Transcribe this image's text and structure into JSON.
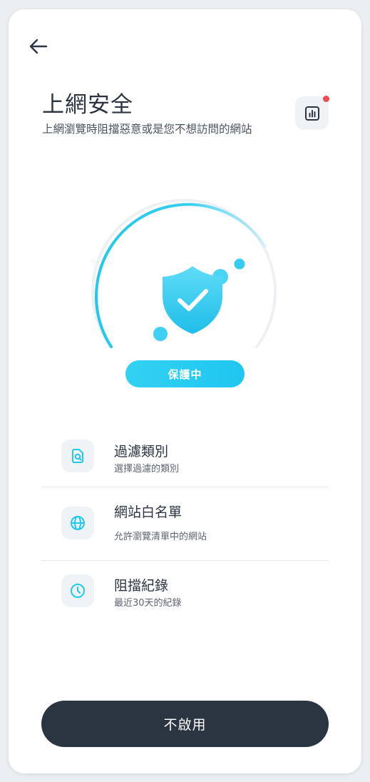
{
  "header": {
    "back_icon": "arrow-left-icon",
    "title": "上網安全",
    "subtitle": "上網瀏覽時阻擋惡意或是您不想訪問的網站",
    "report_icon": "bar-chart-icon",
    "notification_color": "#ee4b4b"
  },
  "status": {
    "label": "保護中",
    "shield_icon": "shield-check-icon",
    "accent": "#22c8f0"
  },
  "menu": {
    "items": [
      {
        "icon": "filter-document-icon",
        "label": "過濾類別",
        "desc": "選擇過濾的類別"
      },
      {
        "icon": "globe-icon",
        "label": "網站白名單",
        "desc": "允許瀏覽清單中的網站"
      },
      {
        "icon": "clock-icon",
        "label": "阻擋紀錄",
        "desc": "最近30天的紀錄"
      }
    ]
  },
  "footer": {
    "disable_label": "不啟用"
  }
}
